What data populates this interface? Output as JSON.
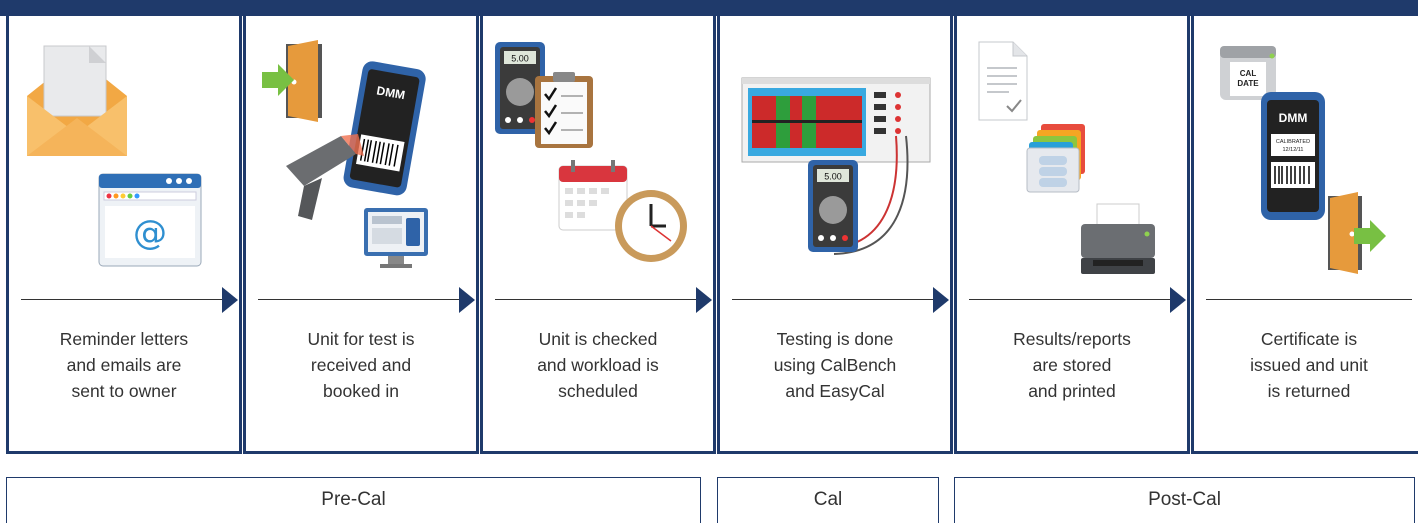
{
  "steps": [
    {
      "caption": "Reminder letters\nand emails are\nsent to owner",
      "icon": "envelope-and-email-icons"
    },
    {
      "caption": "Unit for test is\nreceived and\nbooked in",
      "icon": "door-scanner-dmm-icons"
    },
    {
      "caption": "Unit is checked\nand workload is\nscheduled",
      "icon": "meter-checklist-calendar-clock-icons"
    },
    {
      "caption": "Testing is done\nusing CalBench\nand EasyCal",
      "icon": "calbench-multimeter-icons"
    },
    {
      "caption": "Results/reports\nare stored\nand printed",
      "icon": "document-folders-printer-icons"
    },
    {
      "caption": "Certificate is\nissued and unit\nis returned",
      "icon": "label-dmm-door-icons"
    }
  ],
  "labels": {
    "meter_reading": "5.00",
    "dmm_text": "DMM",
    "cal_date_text": "CAL\nDATE",
    "calibrated_text": "CALIBRATED",
    "calibrated_date": "12/12/11",
    "email_symbol": "@"
  },
  "phases": [
    {
      "label": "Pre-Cal"
    },
    {
      "label": "Cal"
    },
    {
      "label": "Post-Cal"
    }
  ],
  "colors": {
    "navy": "#1f3a6b",
    "meter_blue": "#2f63a8",
    "envelope": "#f3b257",
    "door": "#e69a3c",
    "green_arrow": "#78c043"
  }
}
